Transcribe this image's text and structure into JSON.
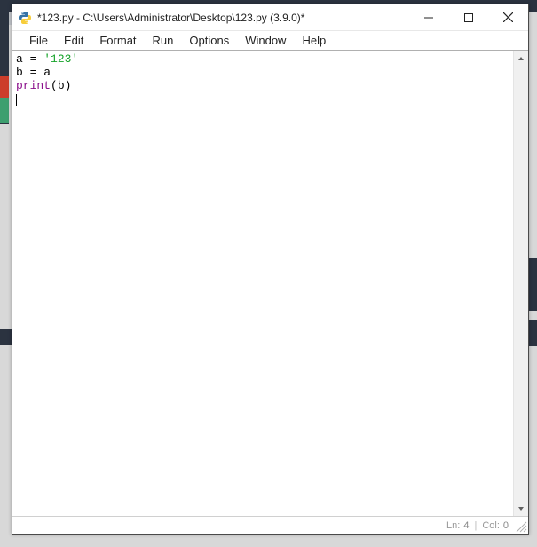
{
  "window": {
    "title": "*123.py - C:\\Users\\Administrator\\Desktop\\123.py (3.9.0)*"
  },
  "menu": {
    "items": [
      "File",
      "Edit",
      "Format",
      "Run",
      "Options",
      "Window",
      "Help"
    ]
  },
  "code": {
    "line1_lhs": "a = ",
    "line1_str": "'123'",
    "line2": "b = a",
    "line3_fn": "print",
    "line3_args": "(b)"
  },
  "status": {
    "ln_label": "Ln:",
    "ln_value": "4",
    "col_label": "Col:",
    "col_value": "0"
  }
}
